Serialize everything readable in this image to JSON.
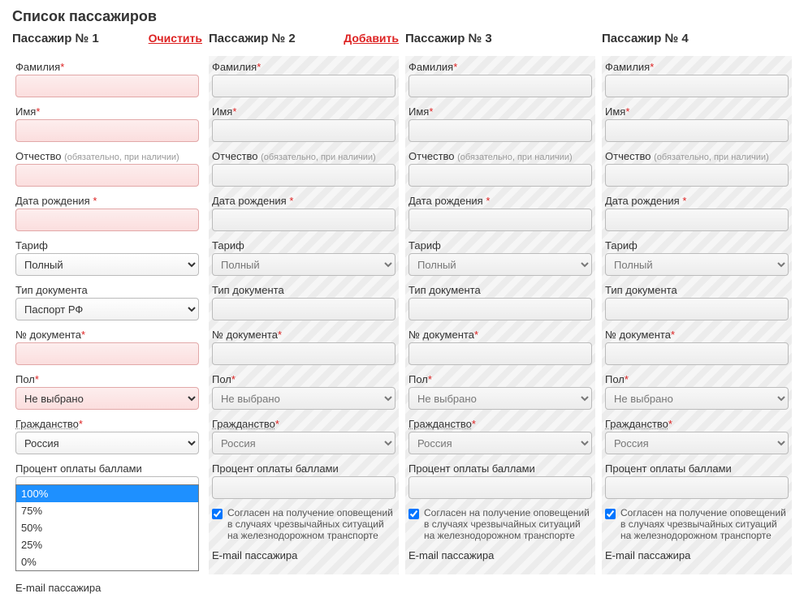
{
  "page_title": "Список пассажиров",
  "labels": {
    "lastname": "Фамилия",
    "firstname": "Имя",
    "patronymic": "Отчество",
    "patronymic_hint": "(обязательно, при наличии)",
    "birthdate": "Дата рождения",
    "tariff": "Тариф",
    "doc_type": "Тип документа",
    "doc_number": "№ документа",
    "gender": "Пол",
    "citizenship": "Гражданство",
    "points_percent": "Процент оплаты баллами",
    "consent": "Согласен на получение оповещений в случаях чрезвычайных ситуаций на железнодорожном транспорте",
    "email": "E-mail пассажира",
    "asterisk": "*"
  },
  "values": {
    "tariff": "Полный",
    "doc_type": "Паспорт РФ",
    "gender": "Не выбрано",
    "citizenship": "Россия",
    "points": "100%"
  },
  "points_options": [
    "100%",
    "75%",
    "50%",
    "25%",
    "0%"
  ],
  "passengers": [
    {
      "title": "Пассажир № 1",
      "action": "Очистить",
      "active": true
    },
    {
      "title": "Пассажир № 2",
      "action": "Добавить",
      "active": false
    },
    {
      "title": "Пассажир № 3",
      "action": "",
      "active": false
    },
    {
      "title": "Пассажир № 4",
      "action": "",
      "active": false
    }
  ]
}
